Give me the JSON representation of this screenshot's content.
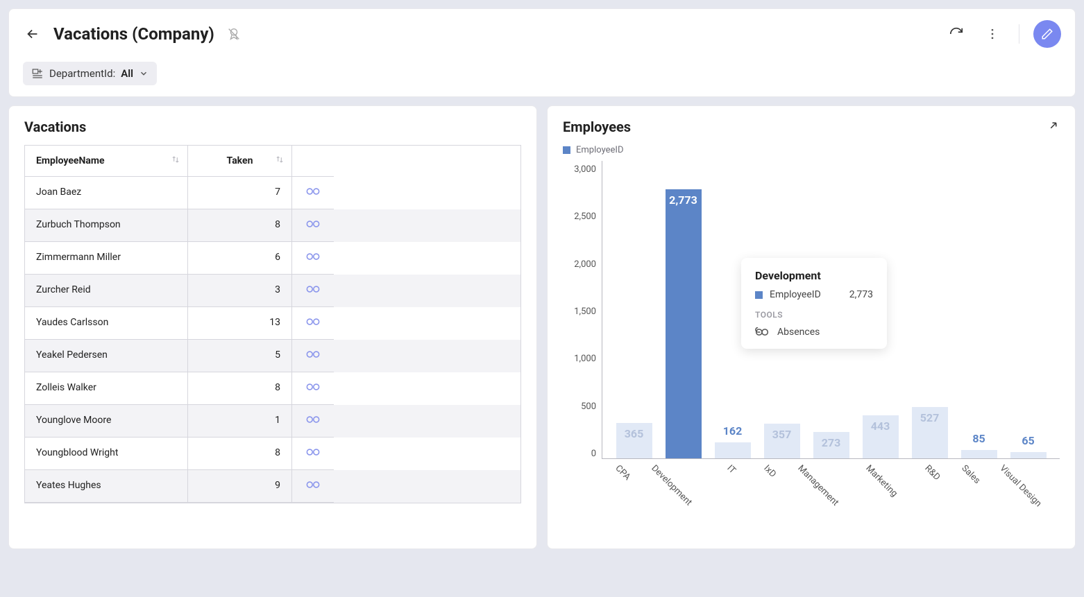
{
  "header": {
    "title": "Vacations (Company)",
    "filter": {
      "label": "DepartmentId:",
      "value": "All"
    }
  },
  "vacations": {
    "title": "Vacations",
    "columns": {
      "name": "EmployeeName",
      "taken": "Taken"
    },
    "rows": [
      {
        "name": "Joan Baez",
        "taken": "7"
      },
      {
        "name": "Zurbuch Thompson",
        "taken": "8"
      },
      {
        "name": "Zimmermann Miller",
        "taken": "6"
      },
      {
        "name": "Zurcher Reid",
        "taken": "3"
      },
      {
        "name": "Yaudes Carlsson",
        "taken": "13"
      },
      {
        "name": "Yeakel Pedersen",
        "taken": "5"
      },
      {
        "name": "Zolleis Walker",
        "taken": "8"
      },
      {
        "name": "Younglove Moore",
        "taken": "1"
      },
      {
        "name": "Youngblood Wright",
        "taken": "8"
      },
      {
        "name": "Yeates Hughes",
        "taken": "9"
      }
    ]
  },
  "employees": {
    "title": "Employees",
    "legend": "EmployeeID",
    "tooltip": {
      "title": "Development",
      "metric": "EmployeeID",
      "value": "2,773",
      "tools_label": "TOOLS",
      "link": "Absences"
    }
  },
  "chart_data": {
    "type": "bar",
    "title": "Employees",
    "ylabel": "",
    "ylim": [
      0,
      3000
    ],
    "yticks": [
      "3,000",
      "2,500",
      "2,000",
      "1,500",
      "1,000",
      "500",
      "0"
    ],
    "categories": [
      "CPA",
      "Development",
      "IT",
      "IxD",
      "Management",
      "Marketing",
      "R&D",
      "Sales",
      "Visual Design"
    ],
    "series": [
      {
        "name": "EmployeeID",
        "values": [
          365,
          2773,
          162,
          357,
          273,
          443,
          527,
          85,
          65
        ]
      }
    ],
    "highlighted_index": 1,
    "labels_display": [
      "365",
      "2,773",
      "162",
      "357",
      "273",
      "443",
      "527",
      "85",
      "65"
    ]
  }
}
